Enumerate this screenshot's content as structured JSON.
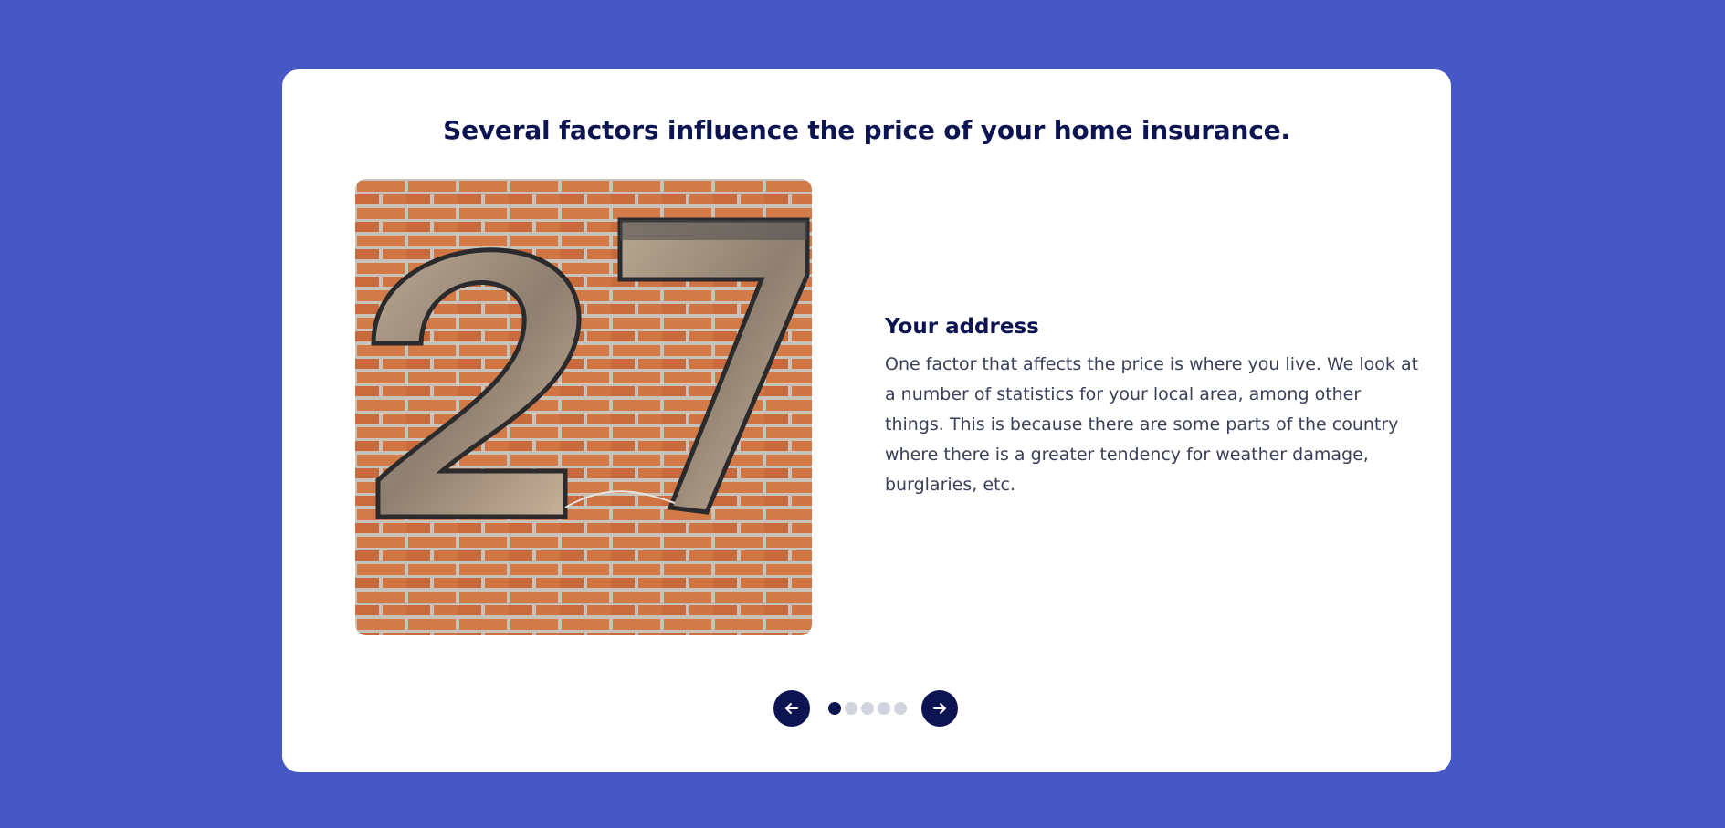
{
  "page": {
    "headline": "Several factors influence the price of your home insurance."
  },
  "slide": {
    "image_subject": "wooden house number 27 on brick wall",
    "house_number_digits": [
      "2",
      "7"
    ],
    "title": "Your address",
    "body": "One factor that affects the price is where you live. We look at a number of statistics for your local area, among other things. This is because there are some parts of the country where there is a greater tendency for weather damage, burglaries, etc."
  },
  "carousel": {
    "prev_icon": "arrow-left-icon",
    "next_icon": "arrow-right-icon",
    "slide_count": 5,
    "active_index": 0
  },
  "colors": {
    "background": "#4558c6",
    "card": "#ffffff",
    "heading": "#0c1552",
    "body_text": "#3a3f57",
    "dot_active": "#0c1552",
    "dot_inactive": "#d2d5de"
  }
}
